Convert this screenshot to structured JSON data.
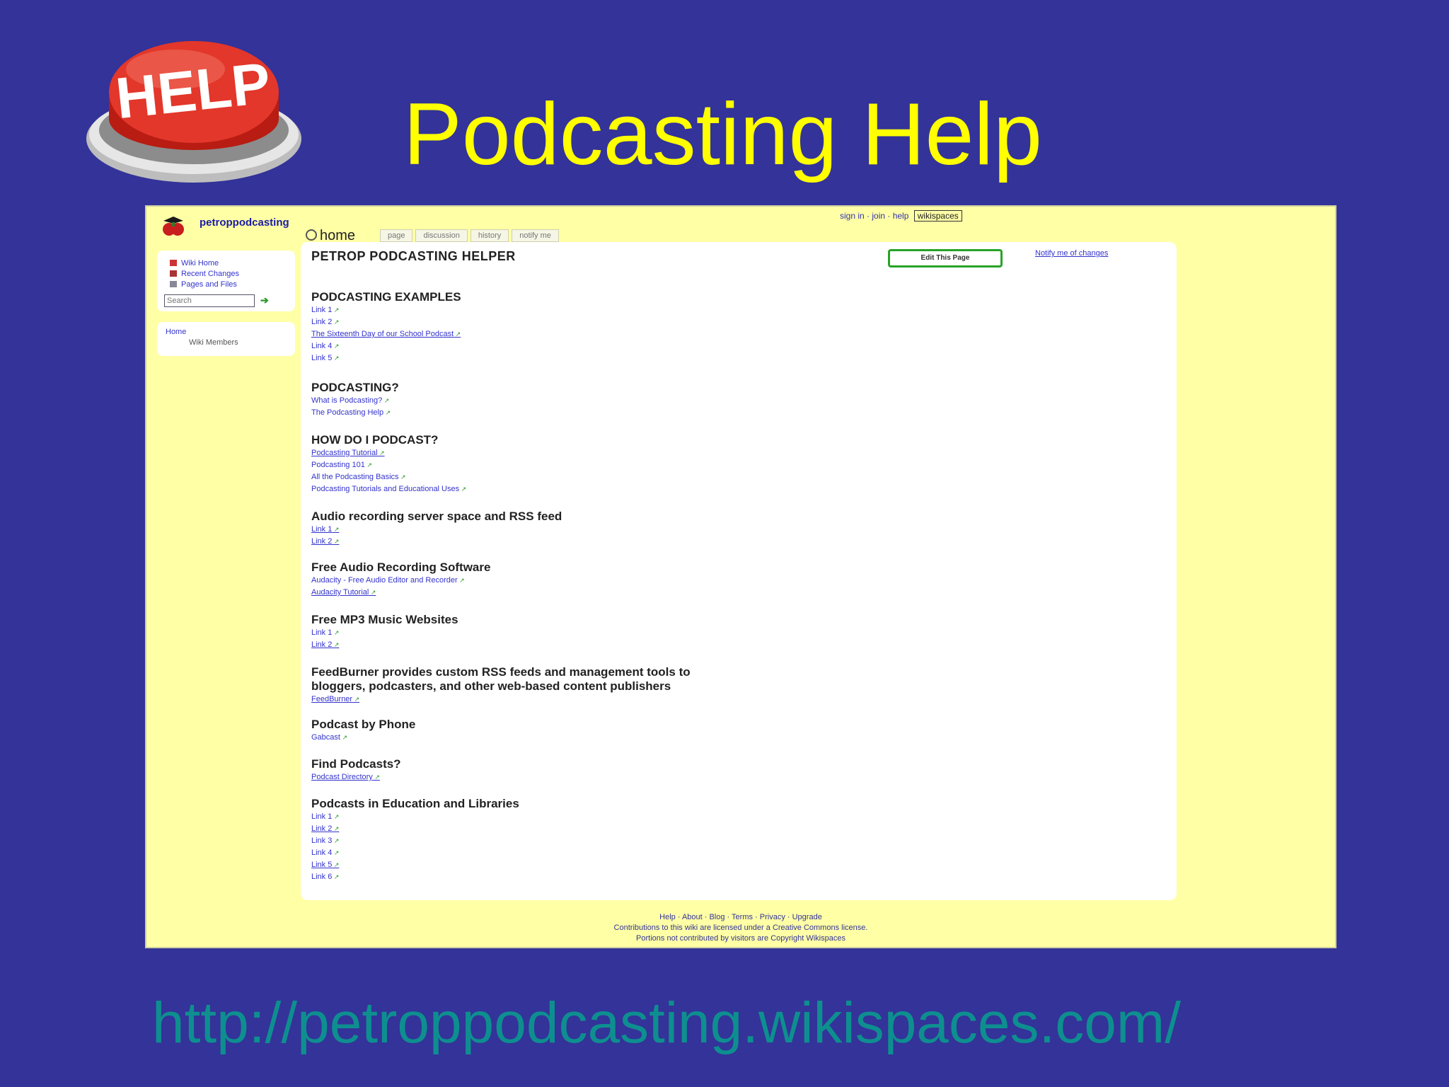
{
  "slide": {
    "title": "Podcasting Help",
    "url": "http://petroppodcasting.wikispaces.com/",
    "help_button_text": "HELP"
  },
  "wiki": {
    "name": "petroppodcasting",
    "top_right_links": "sign in · join · help",
    "top_right_box": "wikispaces",
    "home_label": "home",
    "tabs": [
      "page",
      "discussion",
      "history",
      "notify me"
    ],
    "sidebar": {
      "items": [
        "Wiki Home",
        "Recent Changes",
        "Pages and Files"
      ],
      "search_placeholder": "Search",
      "go_icon": "➔",
      "box2": [
        "Home",
        "Wiki Members"
      ]
    },
    "page_heading": "PETROP PODCASTING HELPER",
    "edit_button": "Edit This Page",
    "notify_link": "Notify me of changes",
    "sections": [
      {
        "title": "PODCASTING EXAMPLES",
        "links": [
          "Link 1",
          "Link 2",
          "The Sixteenth Day of our School Podcast",
          "Link 4",
          "Link 5"
        ]
      },
      {
        "title": "PODCASTING?",
        "links": [
          "What is Podcasting?",
          "The Podcasting Help"
        ]
      },
      {
        "title": "HOW DO I PODCAST?",
        "links": [
          "Podcasting Tutorial",
          "Podcasting 101",
          "All the Podcasting Basics",
          "Podcasting Tutorials and Educational Uses"
        ]
      },
      {
        "title": "Audio recording server space and RSS feed",
        "links": [
          "Link 1",
          "Link 2"
        ]
      },
      {
        "title": "Free Audio Recording Software",
        "links": [
          "Audacity - Free Audio Editor and Recorder",
          "Audacity Tutorial"
        ]
      },
      {
        "title": "Free MP3 Music Websites",
        "links": [
          "Link 1",
          "Link 2"
        ]
      },
      {
        "title": "FeedBurner provides custom RSS feeds and management tools to",
        "title2": "bloggers, podcasters, and other web-based content publishers",
        "links": [
          "FeedBurner"
        ]
      },
      {
        "title": "Podcast by Phone",
        "links": [
          "Gabcast"
        ]
      },
      {
        "title": "Find Podcasts?",
        "links": [
          "Podcast Directory"
        ]
      },
      {
        "title": "Podcasts in Education and Libraries",
        "links": [
          "Link 1",
          "Link 2",
          "Link 3",
          "Link 4",
          "Link 5",
          "Link 6"
        ]
      }
    ],
    "footer": [
      "Help · About · Blog · Terms · Privacy · Upgrade",
      "Contributions to this wiki are licensed under a Creative Commons license.",
      "Portions not contributed by visitors are Copyright Wikispaces"
    ]
  }
}
